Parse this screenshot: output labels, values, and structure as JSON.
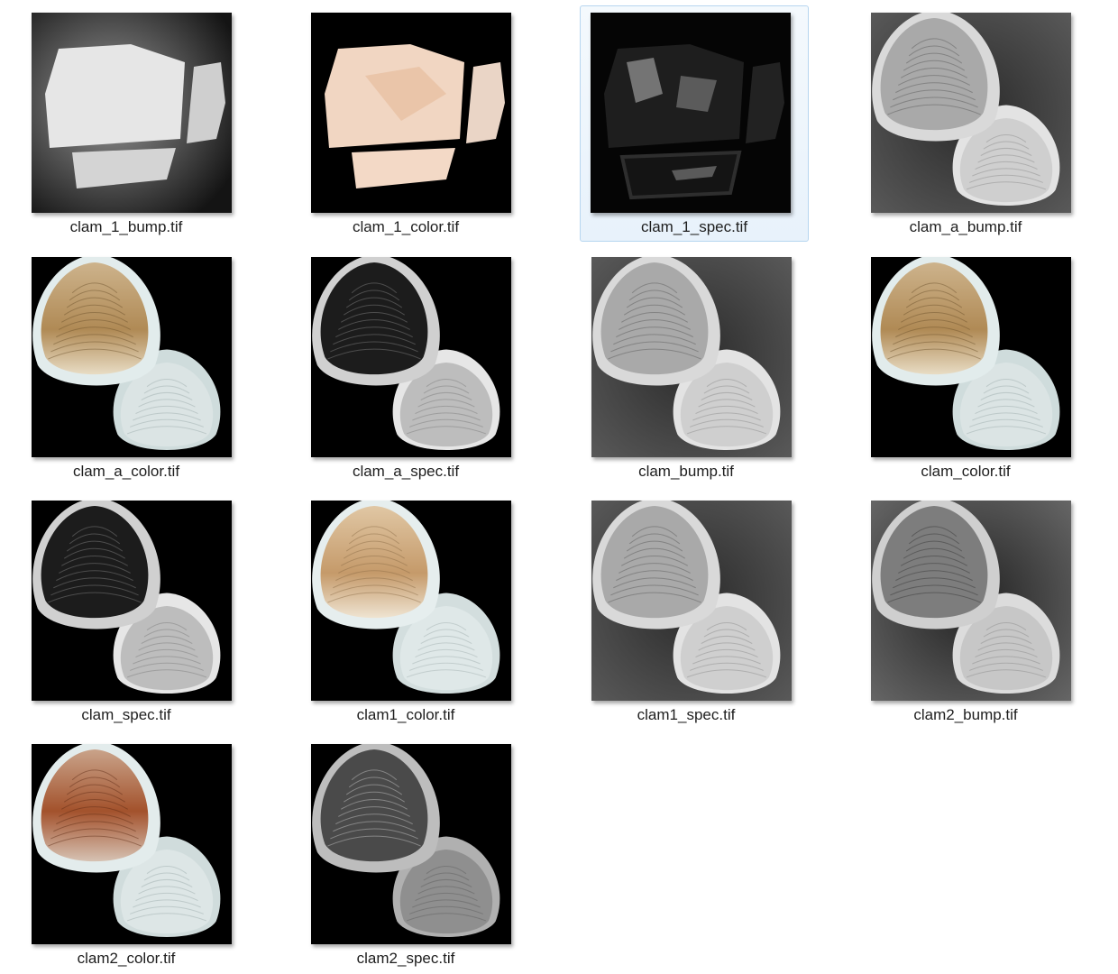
{
  "files": [
    {
      "name": "clam_1_bump.tif",
      "kind": "flat-bump",
      "selected": false
    },
    {
      "name": "clam_1_color.tif",
      "kind": "flat-color",
      "selected": false
    },
    {
      "name": "clam_1_spec.tif",
      "kind": "flat-spec",
      "selected": true
    },
    {
      "name": "clam_a_bump.tif",
      "kind": "shell-bump",
      "selected": false
    },
    {
      "name": "clam_a_color.tif",
      "kind": "shell-color",
      "selected": false
    },
    {
      "name": "clam_a_spec.tif",
      "kind": "shell-spec",
      "selected": false
    },
    {
      "name": "clam_bump.tif",
      "kind": "shell-bump",
      "selected": false
    },
    {
      "name": "clam_color.tif",
      "kind": "shell-color",
      "selected": false
    },
    {
      "name": "clam_spec.tif",
      "kind": "shell-spec",
      "selected": false
    },
    {
      "name": "clam1_color.tif",
      "kind": "shell-color-light",
      "selected": false
    },
    {
      "name": "clam1_spec.tif",
      "kind": "shell-bump",
      "selected": false
    },
    {
      "name": "clam2_bump.tif",
      "kind": "shell-bump-dark",
      "selected": false
    },
    {
      "name": "clam2_color.tif",
      "kind": "shell-color-red",
      "selected": false
    },
    {
      "name": "clam2_spec.tif",
      "kind": "shell-spec-gray",
      "selected": false
    }
  ],
  "icons": {
    "thumbnail": "image-thumbnail-icon"
  },
  "colors": {
    "selection_bg": "#e8f2fb",
    "selection_border": "#b7d6f0"
  }
}
